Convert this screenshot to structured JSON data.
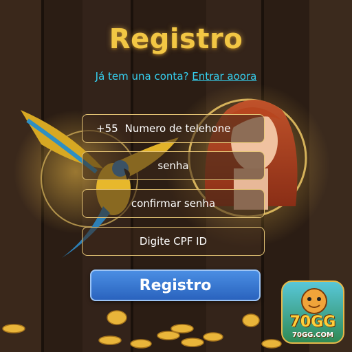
{
  "page": {
    "title": "Registro",
    "subtitle_prefix": "Já tem una conta?",
    "subtitle_link": "Entrar aoora"
  },
  "form": {
    "phone_code": "+55",
    "phone_placeholder": "Numero de telehone",
    "password_placeholder": "senha",
    "confirm_placeholder": "confirmar senha",
    "cpf_placeholder": "Digite CPF ID",
    "submit_label": "Registro"
  },
  "logo": {
    "brand": "70GG",
    "url": "70GG.COM"
  },
  "colors": {
    "title": "#f2c744",
    "link": "#35d0f0",
    "button": "#3a78d4",
    "field_border": "#e8c777"
  }
}
